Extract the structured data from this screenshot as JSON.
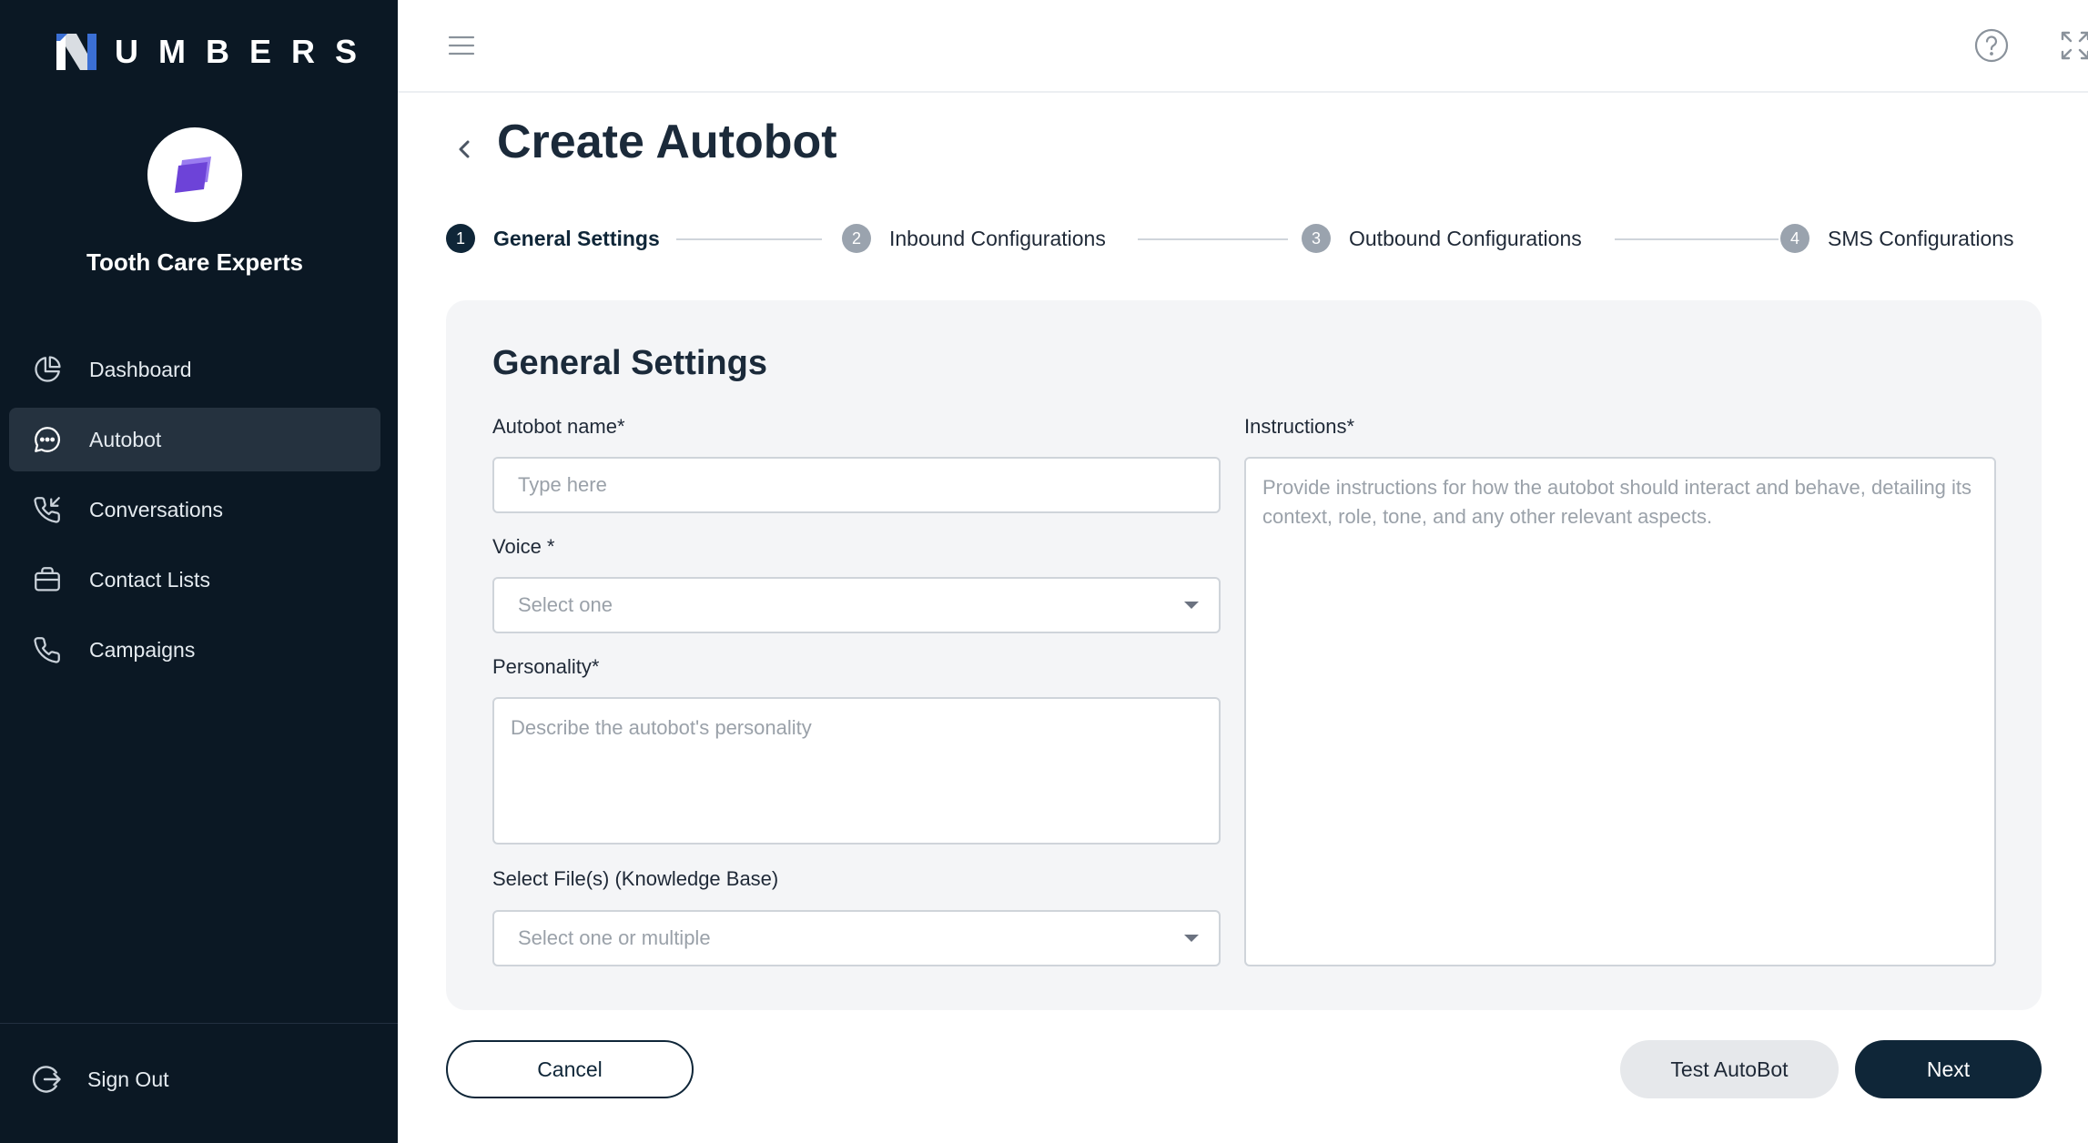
{
  "brand": {
    "logo_text": "UMBERS"
  },
  "org": {
    "name": "Tooth Care Experts"
  },
  "sidebar": {
    "items": [
      {
        "label": "Dashboard",
        "icon": "pie-chart-icon"
      },
      {
        "label": "Autobot",
        "icon": "chat-bubble-icon",
        "active": true
      },
      {
        "label": "Conversations",
        "icon": "phone-incoming-icon"
      },
      {
        "label": "Contact Lists",
        "icon": "briefcase-icon"
      },
      {
        "label": "Campaigns",
        "icon": "phone-icon"
      }
    ],
    "signout_label": "Sign Out"
  },
  "header": {
    "title": "Create Autobot"
  },
  "stepper": {
    "steps": [
      {
        "number": "1",
        "label": "General Settings",
        "active": true
      },
      {
        "number": "2",
        "label": "Inbound Configurations"
      },
      {
        "number": "3",
        "label": "Outbound Configurations"
      },
      {
        "number": "4",
        "label": "SMS Configurations"
      }
    ]
  },
  "form": {
    "title": "General Settings",
    "autobot_name": {
      "label": "Autobot name*",
      "placeholder": "Type here"
    },
    "voice": {
      "label": "Voice *",
      "placeholder": "Select one"
    },
    "personality": {
      "label": "Personality*",
      "placeholder": "Describe the autobot's personality"
    },
    "files": {
      "label": "Select File(s) (Knowledge Base)",
      "placeholder": "Select one or multiple"
    },
    "instructions": {
      "label": "Instructions*",
      "placeholder": "Provide instructions for how the autobot should interact and behave, detailing its context, role, tone, and any other relevant aspects."
    }
  },
  "actions": {
    "cancel_label": "Cancel",
    "test_label": "Test AutoBot",
    "next_label": "Next"
  },
  "colors": {
    "sidebar_bg": "#0b1824",
    "primary": "#0f2638",
    "brand_purple": "#7b4fe0",
    "card_bg": "#f4f5f7"
  }
}
